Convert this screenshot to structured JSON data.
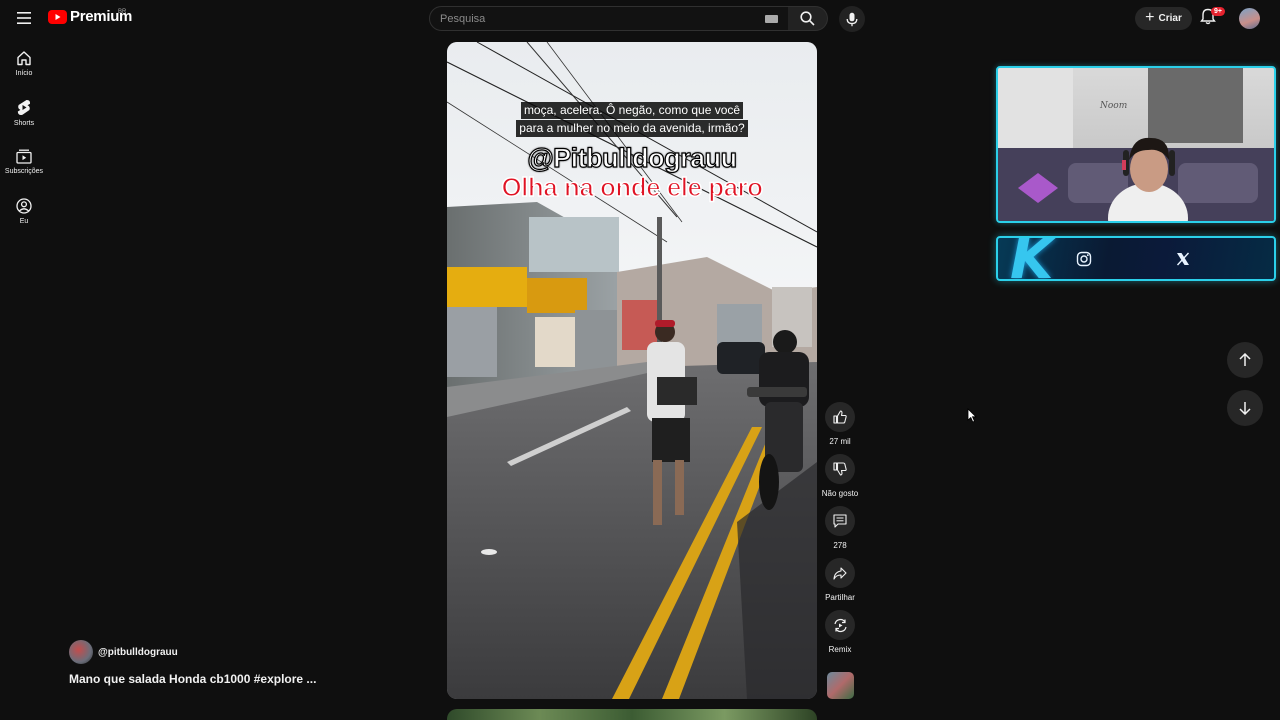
{
  "app": {
    "logo_text": "Premium",
    "country_code": "BR"
  },
  "search": {
    "placeholder": "Pesquisa"
  },
  "header": {
    "create_label": "Criar",
    "notification_badge": "9+"
  },
  "sidebar": {
    "items": [
      {
        "label": "Início",
        "icon": "home-icon"
      },
      {
        "label": "Shorts",
        "icon": "shorts-icon"
      },
      {
        "label": "Subscrições",
        "icon": "subscriptions-icon"
      },
      {
        "label": "Eu",
        "icon": "user-icon"
      }
    ]
  },
  "video": {
    "caption_line1": "moça, acelera. Ô negão, como que você",
    "caption_line2": "para a mulher no meio da avenida, irmão?",
    "overlay_handle": "@Pitbulldograuu",
    "overlay_text": "Olha na onde ele paro"
  },
  "actions": {
    "like_count": "27 mil",
    "dislike_label": "Não gosto",
    "comment_count": "278",
    "share_label": "Partilhar",
    "remix_label": "Remix"
  },
  "channel": {
    "name": "@pitbulldograuu",
    "title": "Mano que salada Honda cb1000 #explore ..."
  },
  "overlays": {
    "brand_letter": "K",
    "accent_color": "#2bd0ea"
  }
}
